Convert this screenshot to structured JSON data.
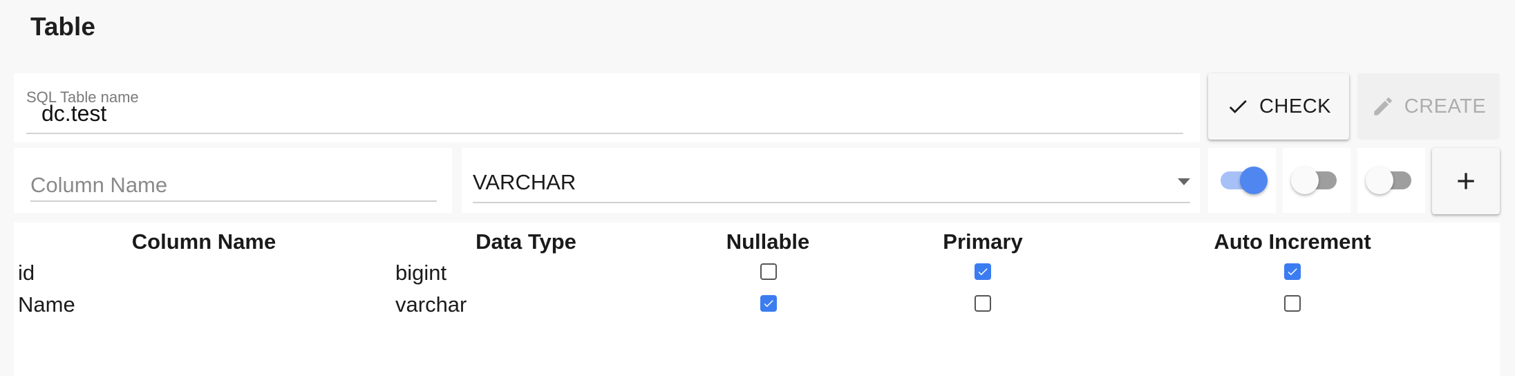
{
  "page": {
    "title": "Table"
  },
  "table_name": {
    "label": "SQL Table name",
    "value": "dc.test"
  },
  "actions": {
    "check_label": "CHECK",
    "create_label": "CREATE"
  },
  "new_column": {
    "name_placeholder": "Column Name",
    "type_selected": "VARCHAR",
    "toggles": {
      "nullable": true,
      "primary": false,
      "auto_increment": false
    },
    "add_icon": "plus-icon"
  },
  "columns_table": {
    "headers": [
      "Column Name",
      "Data Type",
      "Nullable",
      "Primary",
      "Auto Increment"
    ],
    "rows": [
      {
        "name": "id",
        "type": "bigint",
        "nullable": false,
        "primary": true,
        "auto_increment": true
      },
      {
        "name": "Name",
        "type": "varchar",
        "nullable": true,
        "primary": false,
        "auto_increment": false
      }
    ]
  },
  "colors": {
    "accent": "#4f86f0",
    "checkbox": "#3b7cf1",
    "disabled_text": "#adadad"
  }
}
